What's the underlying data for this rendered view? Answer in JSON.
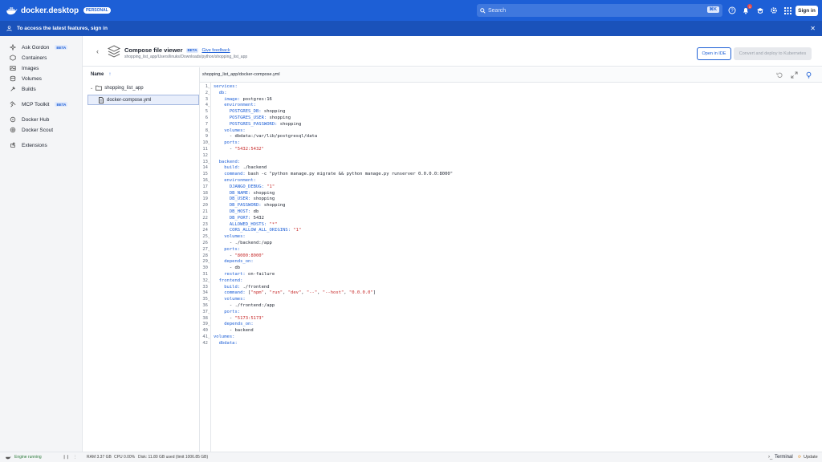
{
  "app": {
    "name": "docker.desktop",
    "badge": "PERSONAL"
  },
  "search": {
    "placeholder": "Search",
    "shortcut": "⌘K"
  },
  "notifications": {
    "count": "1"
  },
  "signin_label": "Sign in",
  "banner": {
    "text": "To access the latest features, sign in"
  },
  "sidebar": {
    "items": [
      {
        "label": "Ask Gordon",
        "beta": "BETA",
        "icon": "gordon-icon"
      },
      {
        "label": "Containers",
        "icon": "containers-icon"
      },
      {
        "label": "Images",
        "icon": "images-icon"
      },
      {
        "label": "Volumes",
        "icon": "volumes-icon"
      },
      {
        "label": "Builds",
        "icon": "builds-icon"
      },
      {
        "label": "MCP Toolkit",
        "beta": "BETA",
        "icon": "mcp-icon"
      },
      {
        "label": "Docker Hub",
        "icon": "hub-icon"
      },
      {
        "label": "Docker Scout",
        "icon": "scout-icon"
      },
      {
        "label": "Extensions",
        "icon": "extensions-icon"
      }
    ]
  },
  "viewer": {
    "title": "Compose file viewer",
    "beta": "BETA",
    "feedback": "Give feedback",
    "path": "shopping_list_app/Users/linuks/Downloads/python/shopping_list_app",
    "open_ide": "Open in IDE",
    "convert": "Convert and deploy to Kubernetes"
  },
  "tree": {
    "header": "Name",
    "header_arrow": "↑",
    "folder": "shopping_list_app",
    "file": "docker-compose.yml"
  },
  "editor": {
    "title": "shopping_list_app/docker-compose.yml"
  },
  "footer": {
    "engine": "Engine running",
    "ram": "RAM 3.37 GB",
    "cpu": "CPU 0.00%",
    "disk": "Disk: 11.80 GB used (limit 1006.85 GB)",
    "terminal": "Terminal",
    "update": "Update"
  },
  "code": [
    {
      "n": "1",
      "f": "⌄",
      "t": [
        [
          "k",
          "services:"
        ]
      ]
    },
    {
      "n": "2",
      "f": "⌄",
      "t": [
        [
          "k",
          "  db:"
        ]
      ]
    },
    {
      "n": "3",
      "t": [
        [
          "k",
          "    image: "
        ],
        [
          "p",
          "postgres:16"
        ]
      ]
    },
    {
      "n": "4",
      "f": "⌄",
      "t": [
        [
          "k",
          "    environment:"
        ]
      ]
    },
    {
      "n": "5",
      "t": [
        [
          "k",
          "      POSTGRES_DB: "
        ],
        [
          "p",
          "shopping"
        ]
      ]
    },
    {
      "n": "6",
      "t": [
        [
          "k",
          "      POSTGRES_USER: "
        ],
        [
          "p",
          "shopping"
        ]
      ]
    },
    {
      "n": "7",
      "t": [
        [
          "k",
          "      POSTGRES_PASSWORD: "
        ],
        [
          "p",
          "shopping"
        ]
      ]
    },
    {
      "n": "8",
      "f": "⌄",
      "t": [
        [
          "k",
          "    volumes:"
        ]
      ]
    },
    {
      "n": "9",
      "t": [
        [
          "p",
          "      - dbdata:/var/lib/postgresql/data"
        ]
      ]
    },
    {
      "n": "10",
      "f": "⌄",
      "t": [
        [
          "k",
          "    ports:"
        ]
      ]
    },
    {
      "n": "11",
      "t": [
        [
          "p",
          "      - "
        ],
        [
          "s",
          "\"5432:5432\""
        ]
      ]
    },
    {
      "n": "12",
      "t": []
    },
    {
      "n": "13",
      "f": "⌄",
      "t": [
        [
          "k",
          "  backend:"
        ]
      ]
    },
    {
      "n": "14",
      "t": [
        [
          "k",
          "    build: "
        ],
        [
          "p",
          "./backend"
        ]
      ]
    },
    {
      "n": "15",
      "t": [
        [
          "k",
          "    command: "
        ],
        [
          "p",
          "bash -c \"python manage.py migrate && python manage.py runserver 0.0.0.0:8000\""
        ]
      ]
    },
    {
      "n": "16",
      "f": "⌄",
      "t": [
        [
          "k",
          "    environment:"
        ]
      ]
    },
    {
      "n": "17",
      "t": [
        [
          "k",
          "      DJANGO_DEBUG: "
        ],
        [
          "s",
          "\"1\""
        ]
      ]
    },
    {
      "n": "18",
      "t": [
        [
          "k",
          "      DB_NAME: "
        ],
        [
          "p",
          "shopping"
        ]
      ]
    },
    {
      "n": "19",
      "t": [
        [
          "k",
          "      DB_USER: "
        ],
        [
          "p",
          "shopping"
        ]
      ]
    },
    {
      "n": "20",
      "t": [
        [
          "k",
          "      DB_PASSWORD: "
        ],
        [
          "p",
          "shopping"
        ]
      ]
    },
    {
      "n": "21",
      "t": [
        [
          "k",
          "      DB_HOST: "
        ],
        [
          "p",
          "db"
        ]
      ]
    },
    {
      "n": "22",
      "t": [
        [
          "k",
          "      DB_PORT: "
        ],
        [
          "p",
          "5432"
        ]
      ]
    },
    {
      "n": "23",
      "t": [
        [
          "k",
          "      ALLOWED_HOSTS: "
        ],
        [
          "s",
          "\"*\""
        ]
      ]
    },
    {
      "n": "24",
      "t": [
        [
          "k",
          "      CORS_ALLOW_ALL_ORIGINS: "
        ],
        [
          "s",
          "\"1\""
        ]
      ]
    },
    {
      "n": "25",
      "f": "⌄",
      "t": [
        [
          "k",
          "    volumes:"
        ]
      ]
    },
    {
      "n": "26",
      "t": [
        [
          "p",
          "      - ./backend:/app"
        ]
      ]
    },
    {
      "n": "27",
      "f": "⌄",
      "t": [
        [
          "k",
          "    ports:"
        ]
      ]
    },
    {
      "n": "28",
      "t": [
        [
          "p",
          "      - "
        ],
        [
          "s",
          "\"8000:8000\""
        ]
      ]
    },
    {
      "n": "29",
      "f": "⌄",
      "t": [
        [
          "k",
          "    depends_on:"
        ]
      ]
    },
    {
      "n": "30",
      "t": [
        [
          "p",
          "      - db"
        ]
      ]
    },
    {
      "n": "31",
      "t": [
        [
          "k",
          "    restart: "
        ],
        [
          "p",
          "on-failure"
        ]
      ]
    },
    {
      "n": "32",
      "f": "⌄",
      "t": [
        [
          "k",
          "  frontend:"
        ]
      ]
    },
    {
      "n": "33",
      "t": [
        [
          "k",
          "    build: "
        ],
        [
          "p",
          "./frontend"
        ]
      ]
    },
    {
      "n": "34",
      "t": [
        [
          "k",
          "    command: "
        ],
        [
          "p",
          "["
        ],
        [
          "s",
          "\"npm\""
        ],
        [
          "p",
          ", "
        ],
        [
          "s",
          "\"run\""
        ],
        [
          "p",
          ", "
        ],
        [
          "s",
          "\"dev\""
        ],
        [
          "p",
          ", "
        ],
        [
          "s",
          "\"--\""
        ],
        [
          "p",
          ", "
        ],
        [
          "s",
          "\"--host\""
        ],
        [
          "p",
          ", "
        ],
        [
          "s",
          "\"0.0.0.0\""
        ],
        [
          "p",
          "]"
        ]
      ]
    },
    {
      "n": "35",
      "f": "⌄",
      "t": [
        [
          "k",
          "    volumes:"
        ]
      ]
    },
    {
      "n": "36",
      "t": [
        [
          "p",
          "      - ./frontend:/app"
        ]
      ]
    },
    {
      "n": "37",
      "f": "⌄",
      "t": [
        [
          "k",
          "    ports:"
        ]
      ]
    },
    {
      "n": "38",
      "t": [
        [
          "p",
          "      - "
        ],
        [
          "s",
          "\"5173:5173\""
        ]
      ]
    },
    {
      "n": "39",
      "f": "⌄",
      "t": [
        [
          "k",
          "    depends_on:"
        ]
      ]
    },
    {
      "n": "40",
      "t": [
        [
          "p",
          "      - backend"
        ]
      ]
    },
    {
      "n": "41",
      "f": "⌄",
      "t": [
        [
          "k",
          "volumes:"
        ]
      ]
    },
    {
      "n": "42",
      "t": [
        [
          "k",
          "  dbdata:"
        ]
      ]
    }
  ]
}
